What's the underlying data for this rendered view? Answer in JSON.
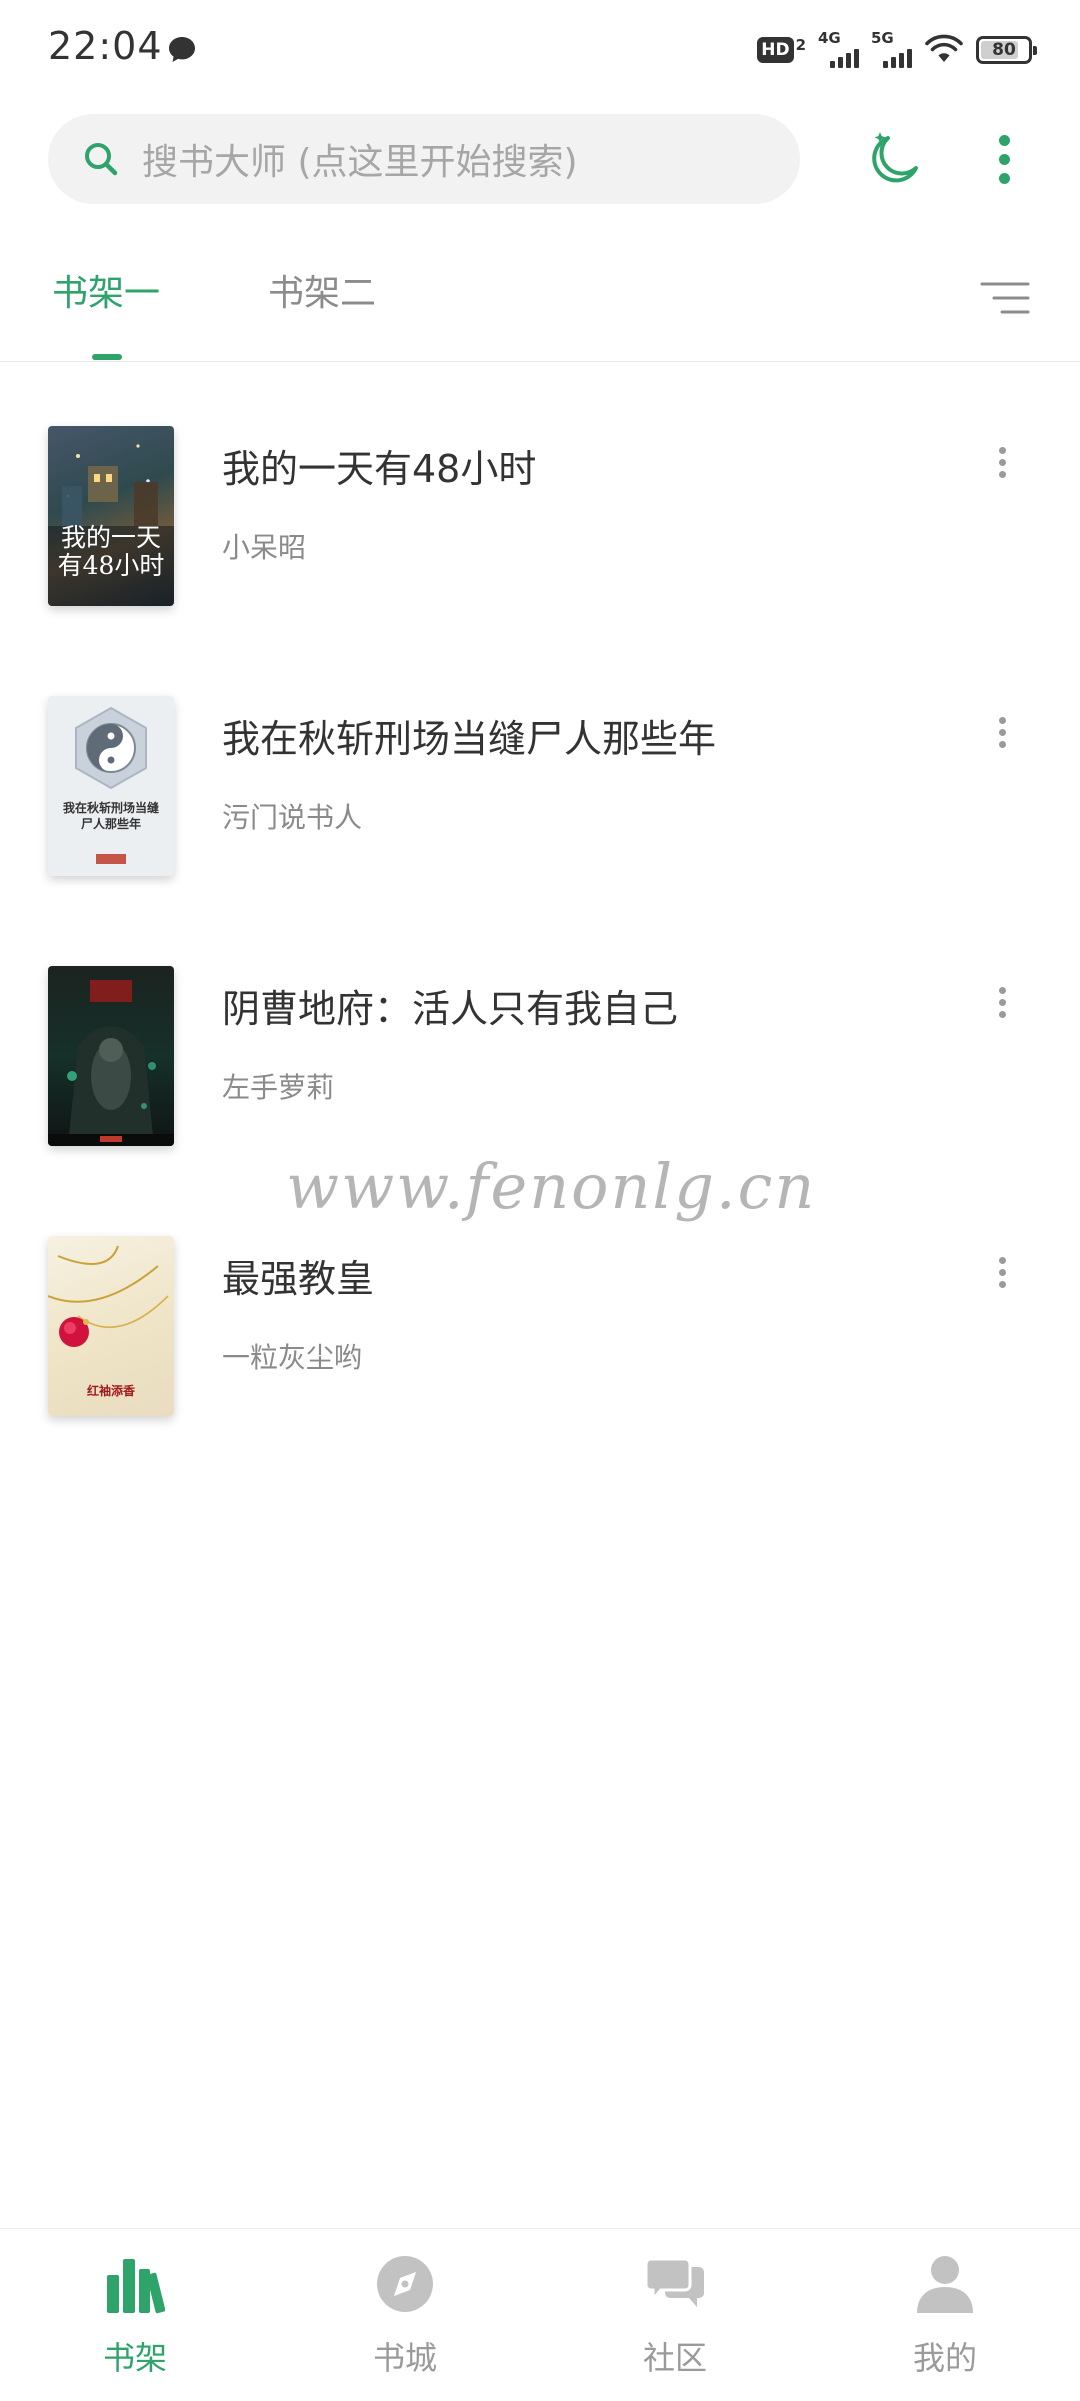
{
  "status_bar": {
    "time": "22:04",
    "hd_label": "HD",
    "hd_sub": "2",
    "network_1": "4G",
    "network_2": "5G",
    "battery_percent": 80,
    "battery_text": "80"
  },
  "search": {
    "placeholder": "搜书大师 (点这里开始搜索)"
  },
  "tabs": [
    {
      "label": "书架一",
      "active": true
    },
    {
      "label": "书架二",
      "active": false
    }
  ],
  "books": [
    {
      "title": "我的一天有48小时",
      "author": "小呆昭",
      "cover_text_line1": "我的一天",
      "cover_text_line2": "有48小时"
    },
    {
      "title": "我在秋斩刑场当缝尸人那些年",
      "author": "污门说书人",
      "cover_text_line1": "我在秋斩刑场当缝",
      "cover_text_line2": "尸人那些年"
    },
    {
      "title": "阴曹地府：活人只有我自己",
      "author": "左手萝莉"
    },
    {
      "title": "最强教皇",
      "author": "一粒灰尘哟",
      "cover_text_line1": "红袖添香"
    }
  ],
  "watermark": "www.fenonlg.cn",
  "bottom_nav": [
    {
      "label": "书架",
      "icon": "bookshelf-icon",
      "active": true
    },
    {
      "label": "书城",
      "icon": "compass-icon",
      "active": false
    },
    {
      "label": "社区",
      "icon": "chat-bubbles-icon",
      "active": false
    },
    {
      "label": "我的",
      "icon": "person-icon",
      "active": false
    }
  ],
  "colors": {
    "accent": "#2ea36a",
    "text_primary": "#333333",
    "text_secondary": "#8a8a8a",
    "nav_inactive": "#9a9a9a",
    "search_bg": "#f2f2f2"
  }
}
